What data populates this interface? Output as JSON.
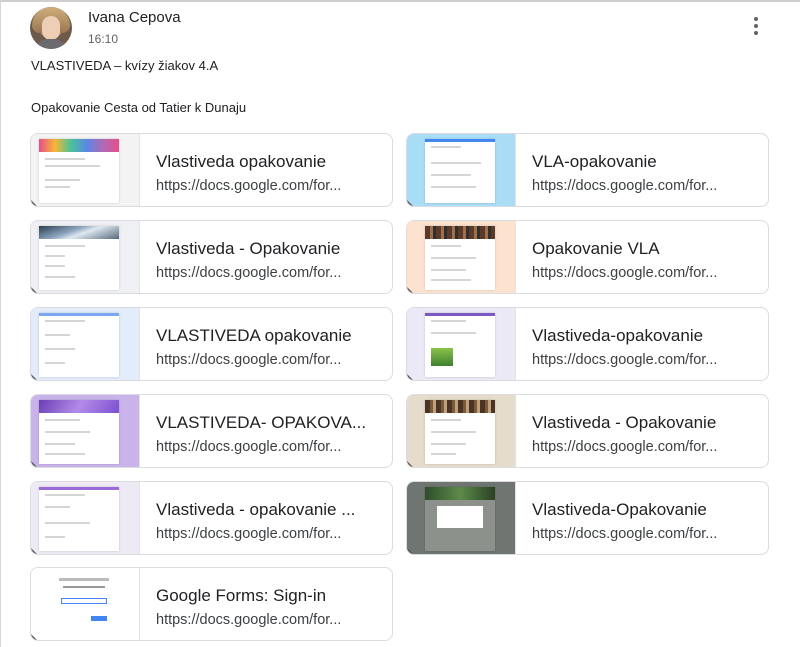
{
  "post": {
    "author": "Ivana Cepova",
    "time": "16:10",
    "line1": "VLASTIVEDA – kvízy žiakov 4.A",
    "line2": "Opakovanie Cesta od Tatier k Dunaju"
  },
  "cards": [
    {
      "title": "Vlastiveda opakovanie",
      "url": "https://docs.google.com/for...",
      "thumb_bg": "#f3f3f3",
      "banner": "rainbow"
    },
    {
      "title": "VLA-opakovanie",
      "url": "https://docs.google.com/for...",
      "thumb_bg": "#a9ddf5",
      "banner": "blue"
    },
    {
      "title": "Vlastiveda - Opakovanie",
      "url": "https://docs.google.com/for...",
      "thumb_bg": "#eef0f3",
      "banner": "mountains"
    },
    {
      "title": "Opakovanie VLA",
      "url": "https://docs.google.com/for...",
      "thumb_bg": "#fde3cf",
      "banner": "books"
    },
    {
      "title": "VLASTIVEDA opakovanie",
      "url": "https://docs.google.com/for...",
      "thumb_bg": "#e3ecfb",
      "banner": "lightblue"
    },
    {
      "title": "Vlastiveda-opakovanie",
      "url": "https://docs.google.com/for...",
      "thumb_bg": "#ece9f6",
      "banner": "purple"
    },
    {
      "title": "VLASTIVEDA- OPAKOVA...",
      "url": "https://docs.google.com/for...",
      "thumb_bg": "#c9b3ea",
      "banner": "violet"
    },
    {
      "title": "Vlastiveda - Opakovanie",
      "url": "https://docs.google.com/for...",
      "thumb_bg": "#e6dccb",
      "banner": "books"
    },
    {
      "title": "Vlastiveda - opakovanie ...",
      "url": "https://docs.google.com/for...",
      "thumb_bg": "#eeeaf5",
      "banner": "purple"
    },
    {
      "title": "Vlastiveda-Opakovanie",
      "url": "https://docs.google.com/for...",
      "thumb_bg": "#6f7570",
      "banner": "forest"
    },
    {
      "title": "Google Forms: Sign-in",
      "url": "https://docs.google.com/for...",
      "thumb_bg": "#ffffff",
      "banner": "signin"
    }
  ]
}
